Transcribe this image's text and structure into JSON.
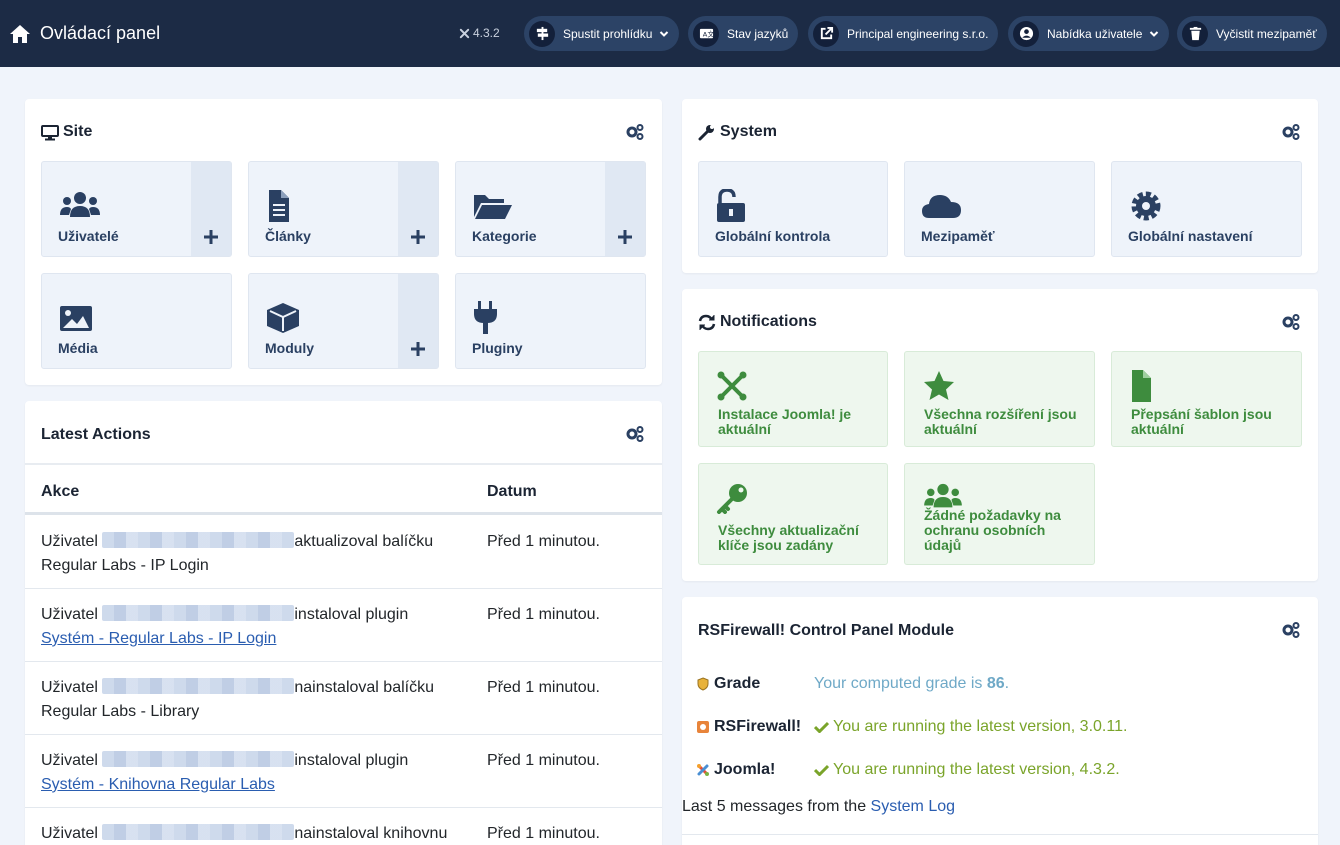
{
  "header": {
    "title": "Ovládací panel",
    "version": "4.3.2",
    "buttons": [
      {
        "label": "Spustit prohlídku",
        "icon": "signpost-icon",
        "dropdown": true
      },
      {
        "label": "Stav jazyků",
        "icon": "language-icon",
        "dropdown": false
      },
      {
        "label": "Principal engineering s.r.o.",
        "icon": "external-link-icon",
        "dropdown": false
      },
      {
        "label": "Nabídka uživatele",
        "icon": "user-circle-icon",
        "dropdown": true
      },
      {
        "label": "Vyčistit mezipaměť",
        "icon": "trash-icon",
        "dropdown": false
      }
    ]
  },
  "site": {
    "title": "Site",
    "tiles": [
      {
        "label": "Uživatelé",
        "icon": "users-icon",
        "add": true
      },
      {
        "label": "Články",
        "icon": "file-icon",
        "add": true
      },
      {
        "label": "Kategorie",
        "icon": "folder-open-icon",
        "add": true
      },
      {
        "label": "Média",
        "icon": "image-icon",
        "add": false
      },
      {
        "label": "Moduly",
        "icon": "cube-icon",
        "add": true
      },
      {
        "label": "Pluginy",
        "icon": "plug-icon",
        "add": false
      }
    ]
  },
  "system": {
    "title": "System",
    "tiles": [
      {
        "label": "Globální kontrola",
        "icon": "unlock-icon"
      },
      {
        "label": "Mezipaměť",
        "icon": "cloud-icon"
      },
      {
        "label": "Globální nastavení",
        "icon": "gear-icon"
      }
    ]
  },
  "notifications": {
    "title": "Notifications",
    "tiles": [
      {
        "label": "Instalace Joomla! je aktuální",
        "icon": "joomla-icon"
      },
      {
        "label": "Všechna rozšíření jsou aktuální",
        "icon": "star-icon"
      },
      {
        "label": "Přepsání šablon jsou aktuální",
        "icon": "file-icon"
      },
      {
        "label": "Všechny aktualizační klíče jsou zadány",
        "icon": "key-icon"
      },
      {
        "label": "Žádné požadavky na ochranu osobních údajů",
        "icon": "users-icon"
      }
    ]
  },
  "latest_actions": {
    "title": "Latest Actions",
    "columns": [
      "Akce",
      "Datum"
    ],
    "rows": [
      {
        "prefix": "Uživatel",
        "action": "aktualizoval balíčku",
        "item": "Regular Labs - IP Login",
        "item_link": false,
        "date": "Před 1 minutou."
      },
      {
        "prefix": "Uživatel",
        "action": "instaloval plugin",
        "item": "Systém - Regular Labs - IP Login",
        "item_link": true,
        "date": "Před 1 minutou."
      },
      {
        "prefix": "Uživatel",
        "action": "nainstaloval balíčku",
        "item": "Regular Labs - Library",
        "item_link": false,
        "date": "Před 1 minutou."
      },
      {
        "prefix": "Uživatel",
        "action": "instaloval plugin",
        "item": "Systém - Knihovna Regular Labs",
        "item_link": true,
        "date": "Před 1 minutou."
      },
      {
        "prefix": "Uživatel",
        "action": "nainstaloval knihovnu",
        "item": "",
        "item_link": false,
        "date": "Před 1 minutou."
      }
    ]
  },
  "rsfirewall": {
    "title": "RSFirewall! Control Panel Module",
    "grade_label": "Grade",
    "grade_text": "Your computed grade is ",
    "grade_value": "86",
    "grade_suffix": ".",
    "rsfirewall_label": "RSFirewall!",
    "rsfirewall_text": "You are running the latest version, 3.0.11.",
    "joomla_label": "Joomla!",
    "joomla_text": "You are running the latest version, 4.3.2.",
    "syslog_text": "Last 5 messages from the ",
    "syslog_link": "System Log"
  },
  "colors": {
    "header_bg": "#1c2b45",
    "button_bg": "#2c4366",
    "tile_icon": "#2a4062",
    "notification_green": "#3e8c3e",
    "link": "#2a5db0"
  }
}
